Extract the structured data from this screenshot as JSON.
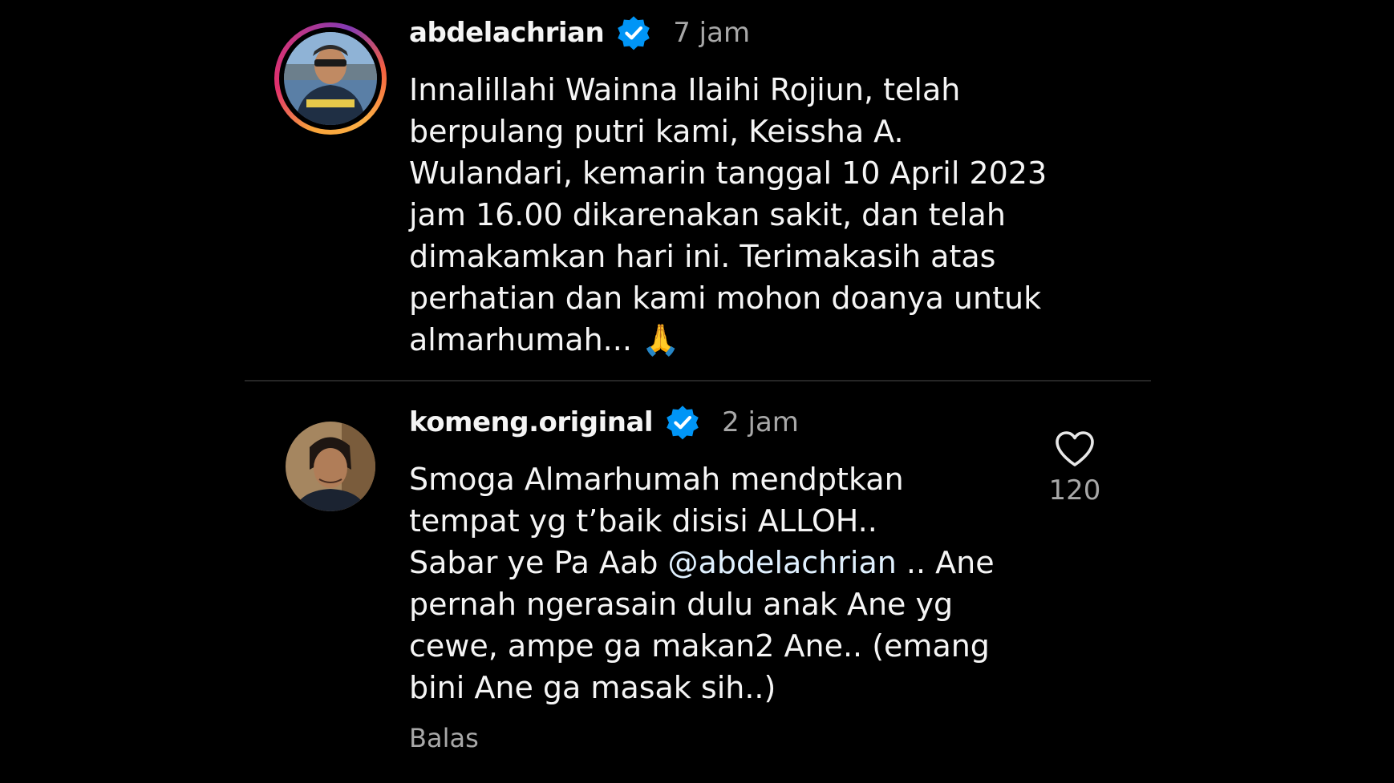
{
  "comments": [
    {
      "username": "abdelachrian",
      "verified": true,
      "time": "7 jam",
      "text": "Innalillahi Wainna Ilaihi Rojiun, telah\nberpulang putri kami, Keissha A.\nWulandari, kemarin tanggal 10 April 2023\njam 16.00 dikarenakan sakit, dan telah\ndimakamkan hari ini. Terimakasih atas\nperhatian dan kami mohon doanya untuk\nalmarhumah... 🙏"
    },
    {
      "username": "komeng.original",
      "verified": true,
      "time": "2 jam",
      "text_before_mention": "Smoga Almarhumah mendptkan\ntempat yg t’baik disisi ALLOH..\nSabar ye Pa Aab ",
      "mention": "@abdelachrian",
      "text_after_mention": " .. Ane\npernah ngerasain dulu anak Ane yg\ncewe, ampe ga makan2 Ane.. (emang\nbini Ane ga masak sih..)",
      "like_count": "120",
      "reply_label": "Balas"
    }
  ],
  "icons": {
    "verified": "verified-badge-icon",
    "like": "heart-outline-icon"
  },
  "colors": {
    "background": "#000000",
    "verified_badge": "#0095f6",
    "secondary_text": "#a8a8a8"
  }
}
